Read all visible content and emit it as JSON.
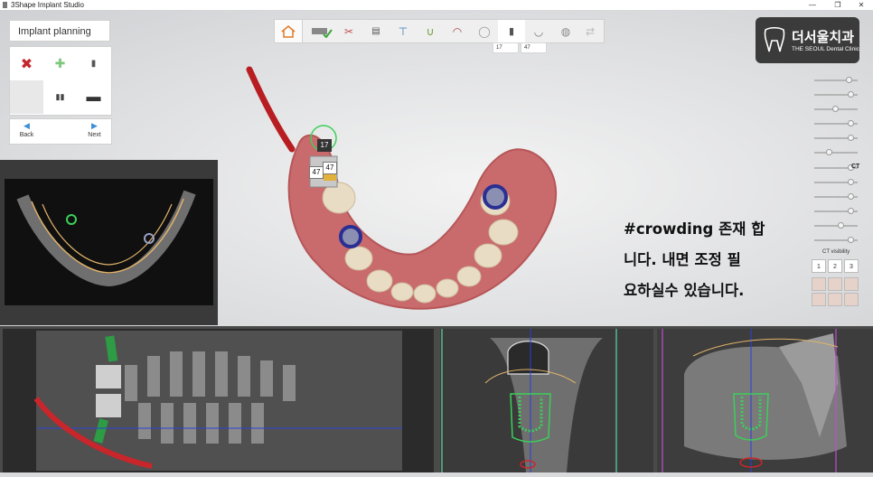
{
  "window": {
    "title": "3Shape Implant Studio",
    "controls": [
      "—",
      "❐",
      "✕"
    ]
  },
  "left_panel": {
    "title": "Implant planning",
    "buttons": [
      {
        "name": "delete",
        "glyph": "✖"
      },
      {
        "name": "add",
        "glyph": "✚"
      },
      {
        "name": "implant",
        "glyph": "▮"
      },
      {
        "name": "empty",
        "glyph": ""
      },
      {
        "name": "abutment",
        "glyph": "▮▮"
      },
      {
        "name": "sleeve",
        "glyph": "▬"
      }
    ],
    "nav": {
      "back": "Back",
      "next": "Next"
    }
  },
  "toolbar": {
    "icons": [
      "home-icon",
      "scan-check-icon",
      "teeth-tool-icon",
      "cassette-icon",
      "implant-crown-icon",
      "arch-icon",
      "jaw-icon",
      "tooth-icon",
      "implant-icon",
      "sleeve-icon",
      "globe-icon",
      "guide-icon"
    ]
  },
  "subtabs": [
    "17",
    "47"
  ],
  "logo": {
    "korean": "더서울치과",
    "english": "THE SEOUL Dental Clinic"
  },
  "labels": {
    "implant_top": "17",
    "implant_bottom": "47"
  },
  "annotation": {
    "line1": "#crowding 존재 합",
    "line2": "니다. 내면 조정 필",
    "line3": "요하실수 있습니다."
  },
  "right_controls": {
    "ct_label": "CT",
    "ct_visibility": "CT visibility",
    "view_buttons": [
      "1",
      "2",
      "3"
    ],
    "slider_levels": [
      0.8,
      0.85,
      0.45,
      0.85,
      0.85,
      0.3,
      0.85,
      0.85,
      0.85,
      0.85,
      0.6,
      0.85
    ]
  },
  "colors": {
    "accent": "#3c8fd8",
    "implant_green": "#3ccf5a",
    "nerve_red": "#c9262b"
  }
}
